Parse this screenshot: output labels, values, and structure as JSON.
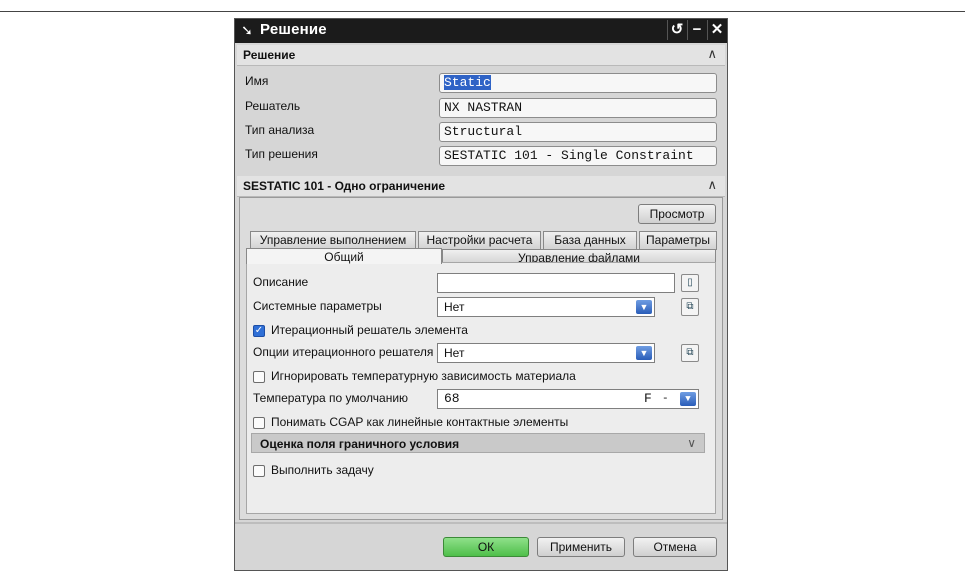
{
  "dialog": {
    "title": "Решение",
    "controls": {
      "reset": "↺",
      "minimize": "−",
      "close": "✕"
    }
  },
  "solution_section": {
    "title": "Решение",
    "chevron": "∧",
    "fields": [
      {
        "label": "Имя",
        "value": "Static"
      },
      {
        "label": "Решатель",
        "value": "NX NASTRAN"
      },
      {
        "label": "Тип анализа",
        "value": "Structural"
      },
      {
        "label": "Тип решения",
        "value": "SESTATIC 101 - Single Constraint"
      }
    ]
  },
  "sestatic_section": {
    "title": "SESTATIC 101 - Одно ограничение",
    "chevron": "∧",
    "preview_button": "Просмотр",
    "tabs_row1": [
      "Управление выполнением",
      "Настройки расчета",
      "База данных",
      "Параметры"
    ],
    "tabs_row2": [
      "Общий",
      "Управление файлами"
    ],
    "selected_tab": "Общий",
    "general": {
      "description_label": "Описание",
      "description_value": "",
      "system_params_label": "Системные параметры",
      "system_params_value": "Нет",
      "iterative_solver_label": "Итерационный решатель элемента",
      "iterative_solver_checked": true,
      "iterative_options_label": "Опции итерационного решателя",
      "iterative_options_value": "Нет",
      "ignore_temp_label": "Игнорировать температурную зависимость материала",
      "ignore_temp_checked": false,
      "default_temp_label": "Температура по умолчанию",
      "default_temp_value": "68",
      "default_temp_unit": "F",
      "cgap_label": "Понимать CGAP как линейные контактные элементы",
      "cgap_checked": false,
      "boundary_section_title": "Оценка поля граничного условия",
      "boundary_chevron": "∨",
      "run_task_label": "Выполнить задачу",
      "run_task_checked": false
    }
  },
  "footer": {
    "ok": "ОК",
    "apply": "Применить",
    "cancel": "Отмена"
  },
  "colors": {
    "titlebar": "#1b1b1b",
    "ok_green": "#5fc65a",
    "selection": "#2f63c6"
  }
}
